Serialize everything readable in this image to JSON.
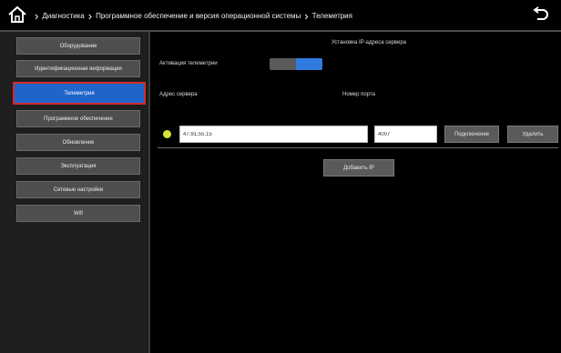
{
  "header": {
    "breadcrumbs": [
      "Диагностика",
      "Программное обеспечение и версия операционной системы",
      "Телеметрия"
    ]
  },
  "sidebar": {
    "items": [
      {
        "label": "Оборудование"
      },
      {
        "label": "Идентификационная информация"
      },
      {
        "label": "Телеметрия"
      },
      {
        "label": "Программное обеспечение"
      },
      {
        "label": "Обновление"
      },
      {
        "label": "Эксплуатация"
      },
      {
        "label": "Сетевые настройки"
      },
      {
        "label": "Wifi"
      }
    ],
    "active_index": 2
  },
  "main": {
    "section_title": "Установка IP-адреса сервера",
    "telemetry_label": "Активация телеметрии",
    "telemetry_enabled": true,
    "address_header": "Адрес сервера",
    "port_header": "Номер порта",
    "server_address": "47.91.55.15",
    "port": "4007",
    "connect_button": "Подключение",
    "delete_button": "Удалить",
    "add_ip_button": "Добавить IP"
  },
  "colors": {
    "active_item": "#1f64c9",
    "active_border": "#d42a2a",
    "toggle_on": "#2f7be0",
    "status_dot": "#d8e23a"
  }
}
